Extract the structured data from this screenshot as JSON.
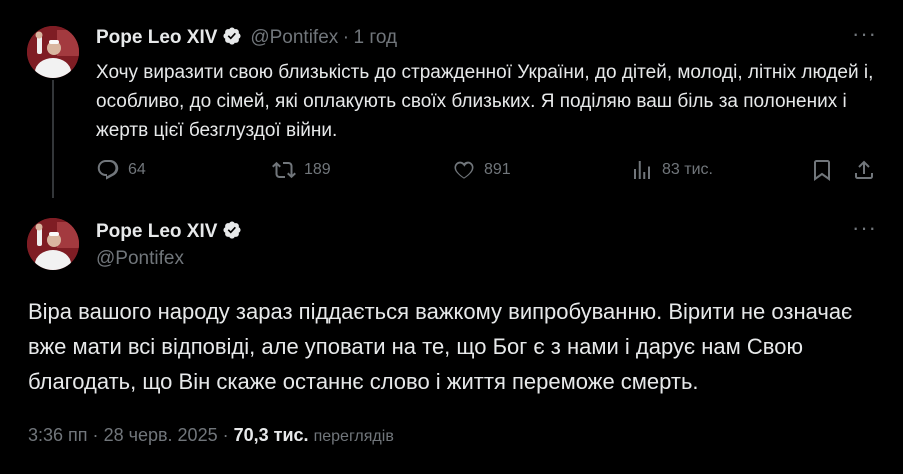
{
  "tweet1": {
    "name": "Pope Leo XIV",
    "handle": "@Pontifex",
    "separator": "·",
    "time": "1 год",
    "text": "Хочу виразити свою близькість до стражденної України, до дітей, молоді, літніх людей і, особливо, до сімей, які оплакують своїх близьких. Я поділяю ваш біль за полонених і жертв цієї безглуздої війни.",
    "actions": {
      "replies": "64",
      "reposts": "189",
      "likes": "891",
      "views": "83 тис."
    }
  },
  "tweet2": {
    "name": "Pope Leo XIV",
    "handle": "@Pontifex",
    "text": "Віра вашого народу зараз піддається важкому випробуванню. Вірити не означає вже мати всі відповіді, але уповати на те, що Бог є з нами і дарує нам Свою благодать, що Він скаже останнє слово і життя переможе смерть.",
    "meta": {
      "time": "3:36 пп",
      "dot1": "·",
      "date": "28 черв. 2025",
      "dot2": "·",
      "views_count": "70,3 тис.",
      "views_label": "переглядів"
    }
  },
  "icons": {
    "verified": "verified-badge-icon",
    "more": "more-options-icon",
    "reply": "reply-icon",
    "repost": "repost-icon",
    "like": "like-icon",
    "views": "views-icon",
    "bookmark": "bookmark-icon",
    "share": "share-icon"
  },
  "colors": {
    "background": "#000000",
    "text": "#e7e9ea",
    "muted": "#71767b",
    "verified": "#1d9bf0"
  }
}
